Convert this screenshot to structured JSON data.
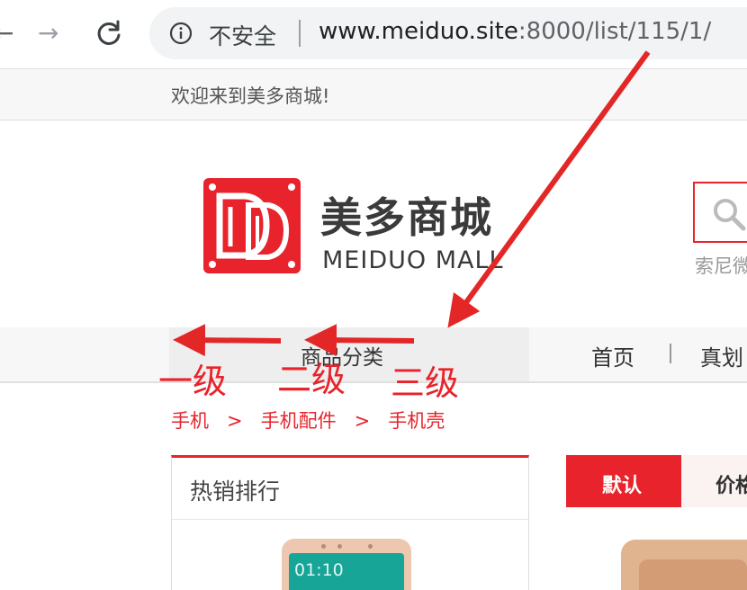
{
  "browser": {
    "back_icon": "arrow-left-icon",
    "forward_icon": "arrow-right-icon",
    "reload_icon": "reload-icon",
    "info_icon": "info-icon",
    "security_label": "不安全",
    "url_host": "www.meiduo.site",
    "url_rest": ":8000/list/115/1/"
  },
  "topbar": {
    "welcome": "欢迎来到美多商城!"
  },
  "header": {
    "logo_icon": "meiduo-logo-icon",
    "logo_title": "美多商城",
    "logo_subtitle": "MEIDUO MALL",
    "search_icon": "search-icon",
    "search_hint": "索尼微"
  },
  "nav": {
    "category_label": "商品分类",
    "home_label": "首页",
    "item2_label": "真划"
  },
  "annotation": {
    "level1": "一级",
    "level2": "二级",
    "level3": "三级",
    "color": "#e8232b"
  },
  "breadcrumb": {
    "items": [
      "手机",
      "手机配件",
      "手机壳"
    ],
    "separator": ">"
  },
  "hot_sales": {
    "title": "热销排行",
    "phone_time": "01:10"
  },
  "sort": {
    "default_label": "默认",
    "price_label": "价格"
  },
  "colors": {
    "brand_red": "#e8232b",
    "topbar_bg": "#f7f7f7"
  }
}
